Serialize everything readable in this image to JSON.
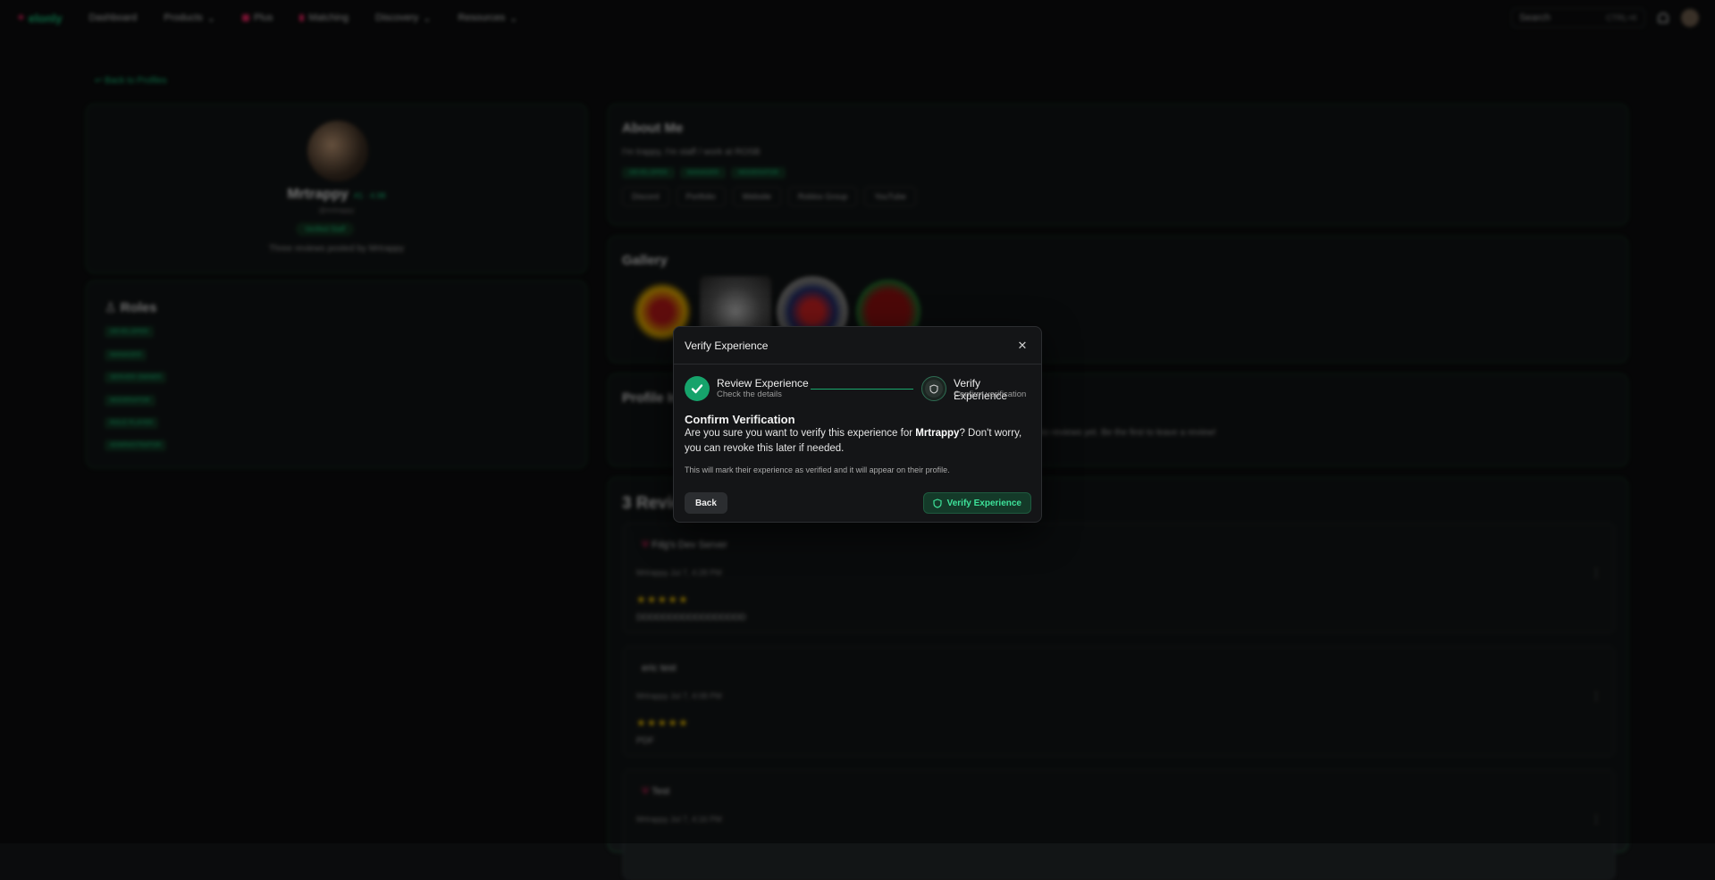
{
  "navbar": {
    "logo": "elonly",
    "items": [
      "Dashboard",
      "Products",
      "Plus",
      "Matching",
      "Discovery",
      "Resources"
    ],
    "search_placeholder": "Search",
    "search_shortcut": "CTRL+K"
  },
  "back_link": "Back to Profiles",
  "profile": {
    "username": "Mrtrappy",
    "username_tag": "#1 · 4.98",
    "subname": "@mrtrappy",
    "badge": "Verified Staff",
    "reviews_posted": "Three reviews posted by Mrtrappy"
  },
  "roles": {
    "title": "Roles",
    "items": [
      "DEVELOPER",
      "MANAGER",
      "SERVER OWNER",
      "MODERATOR",
      "ROLE PLAYER",
      "ADMINISTRATOR"
    ]
  },
  "about": {
    "title": "About Me",
    "text": "I'm trappy, I'm staff / work at ROSB",
    "tags": [
      "DEVELOPER",
      "MANAGER",
      "MODERATOR"
    ],
    "links": [
      "Discord",
      "Portfolio",
      "Website",
      "Roblox Group",
      "YouTube"
    ]
  },
  "gallery": {
    "title": "Gallery"
  },
  "profile_info": {
    "title": "Profile Info",
    "empty_text": "No reviews yet. Be the first to leave a review!"
  },
  "reviews": {
    "title": "3 Reviews",
    "items": [
      {
        "server": "Fdg's Dev Server",
        "user": "Mrtrappy",
        "date": "Jul 7, 4:28 PM",
        "stars": "★★★★★",
        "body": "DDDDDDDDDDDDDDDDD"
      },
      {
        "server": "eric test",
        "user": "Mrtrappy",
        "date": "Jul 7, 4:08 PM",
        "stars": "★★★★★",
        "body": "PDF"
      },
      {
        "server": "Test",
        "user": "Mrtrappy",
        "date": "Jul 7, 4:16 PM",
        "stars": "★★★★★",
        "body": ""
      }
    ]
  },
  "modal": {
    "title": "Verify Experience",
    "step1_title": "Review Experience",
    "step1_sub": "Check the details",
    "step2_title": "Verify Experience",
    "step2_sub": "Confirm verification",
    "heading": "Confirm Verification",
    "body_prefix": "Are you sure you want to verify this experience for ",
    "body_name": "Mrtrappy",
    "body_suffix": "? Don't worry, you can revoke this later if needed.",
    "note": "This will mark their experience as verified and it will appear on their profile.",
    "back_label": "Back",
    "verify_label": "Verify Experience"
  },
  "colors": {
    "accent": "#19c37d",
    "modal_bg": "#141517",
    "verify_button_bg": "#143a29",
    "verify_button_text": "#3ee29a",
    "step_done": "#16a36b"
  }
}
